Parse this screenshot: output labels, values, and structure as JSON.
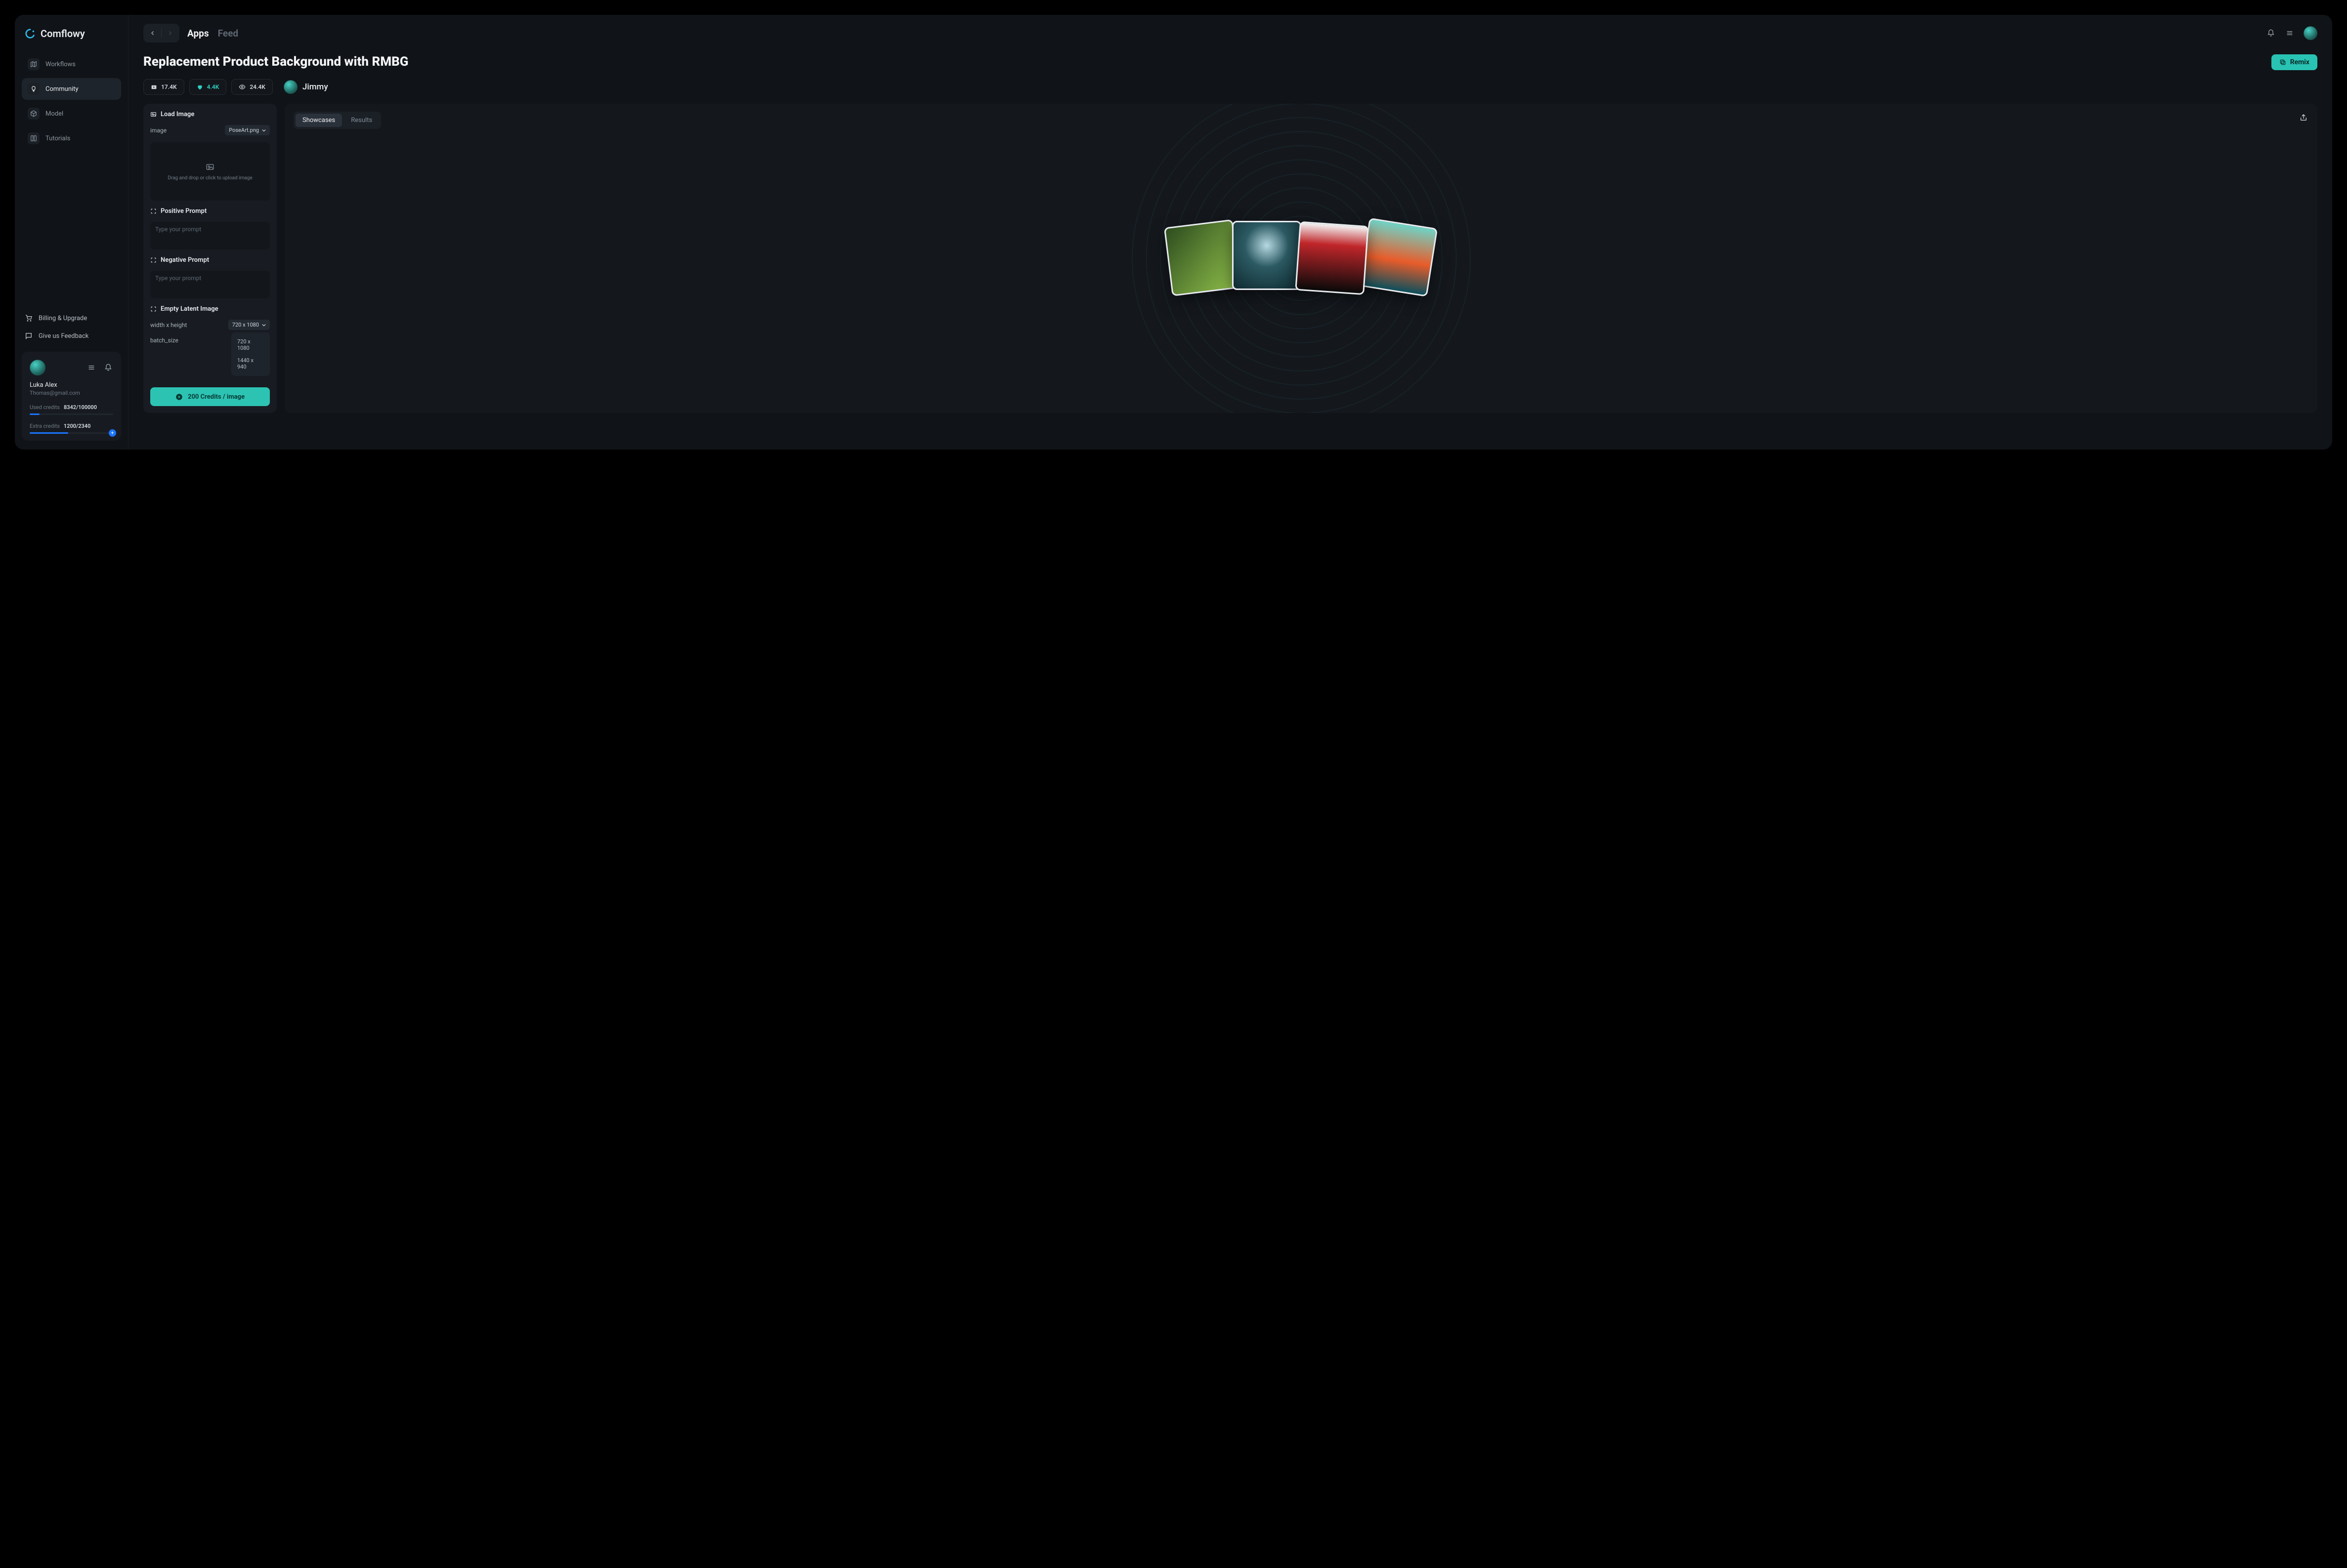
{
  "brand": {
    "name": "Comflowy"
  },
  "sidebar": {
    "items": [
      {
        "label": "Workflows"
      },
      {
        "label": "Community"
      },
      {
        "label": "Model"
      },
      {
        "label": "Tutorials"
      }
    ],
    "secondary": [
      {
        "label": "Billing & Upgrade"
      },
      {
        "label": "Give us Feedback"
      }
    ]
  },
  "user_card": {
    "name": "Luka Alex",
    "email": "Thomas@gmail.com",
    "used_credits_label": "Used credits",
    "used_credits_value": "8342/100000",
    "extra_credits_label": "Extra credits",
    "extra_credits_value": "1200/2340"
  },
  "top_tabs": {
    "apps": "Apps",
    "feed": "Feed"
  },
  "page": {
    "title": "Replacement Product Background with RMBG",
    "remix": "Remix",
    "plays": "17.4K",
    "likes": "4.4K",
    "views": "24.4K",
    "author": "Jimmy"
  },
  "form": {
    "load_image": {
      "title": "Load Image",
      "label": "image",
      "filename": "PoseArt.png",
      "drop_hint": "Drag and drop or click to upload image"
    },
    "pos_prompt": {
      "title": "Positive Prompt",
      "placeholder": "Type your prompt"
    },
    "neg_prompt": {
      "title": "Negative Prompt",
      "placeholder": "Type your prompt"
    },
    "latent": {
      "title": "Empty Latent Image",
      "wh_label": "width x height",
      "wh_selected": "720 x 1080",
      "wh_options": [
        "720 x 1080",
        "1440  x 940"
      ],
      "batch_label": "batch_size"
    },
    "run_label": "200 Credits / image"
  },
  "showcase": {
    "tab_showcases": "Showcases",
    "tab_results": "Results"
  }
}
